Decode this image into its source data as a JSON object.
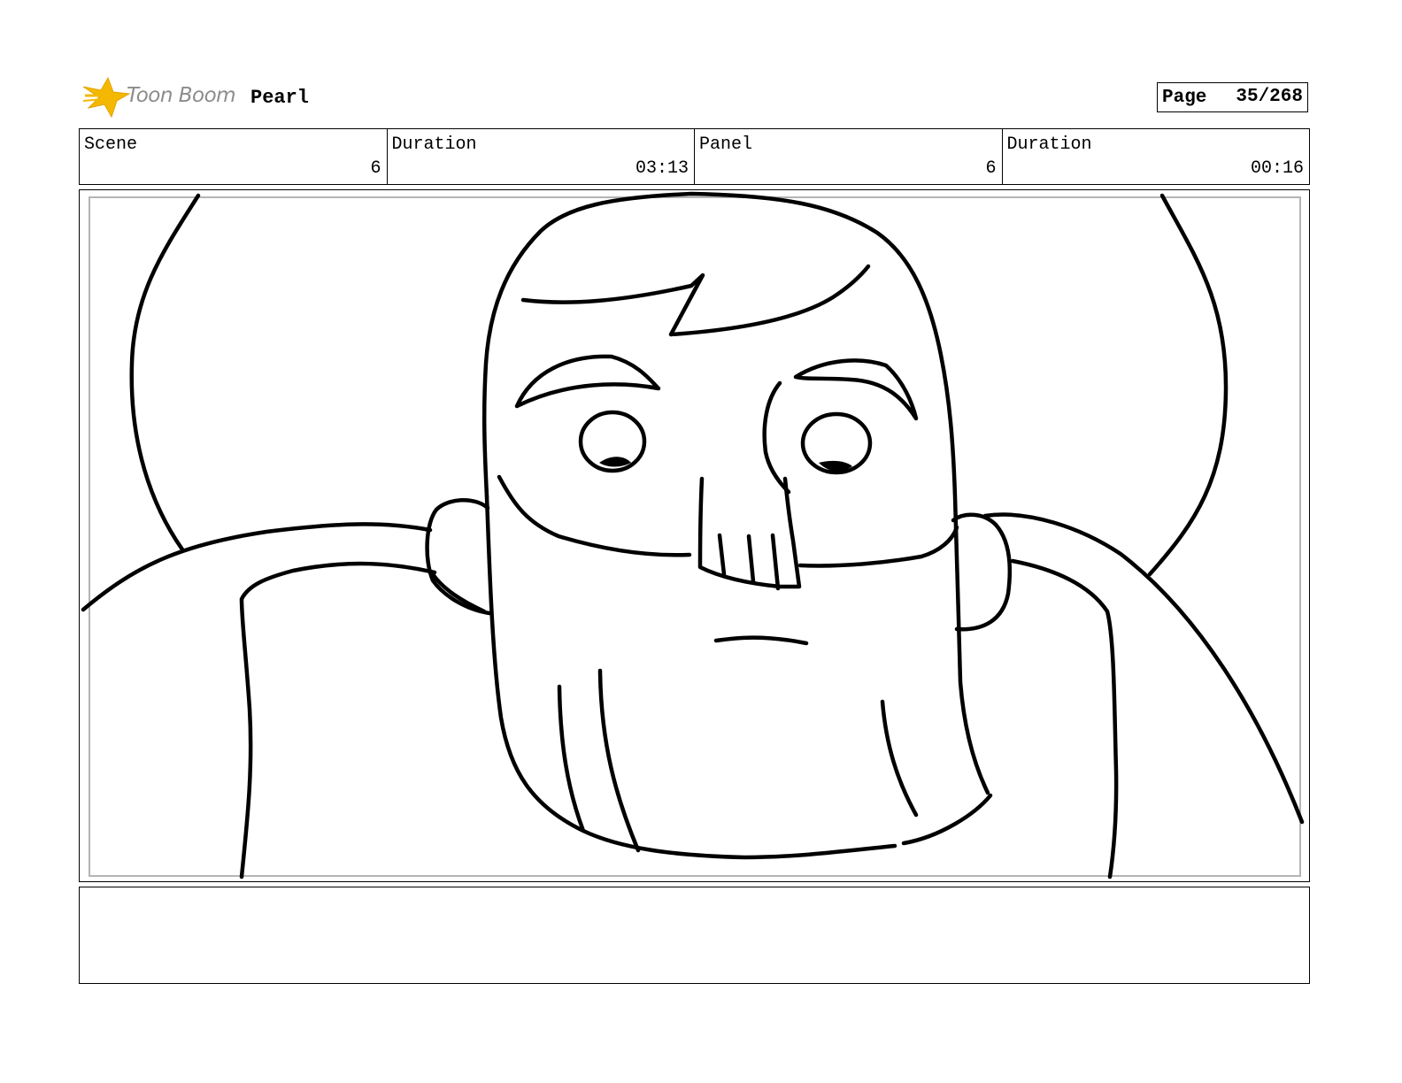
{
  "header": {
    "logo_text": "Toon Boom",
    "project_title": "Pearl",
    "page_label": "Page",
    "page_number": "35/268"
  },
  "info": {
    "scene_label": "Scene",
    "scene_value": "6",
    "scene_duration_label": "Duration",
    "scene_duration_value": "03:13",
    "panel_label": "Panel",
    "panel_value": "6",
    "panel_duration_label": "Duration",
    "panel_duration_value": "00:16"
  },
  "colors": {
    "logo_accent": "#f5b800",
    "logo_text": "#8c8c8c",
    "safe_frame": "#b4b4b4"
  },
  "notes": {
    "text": ""
  }
}
